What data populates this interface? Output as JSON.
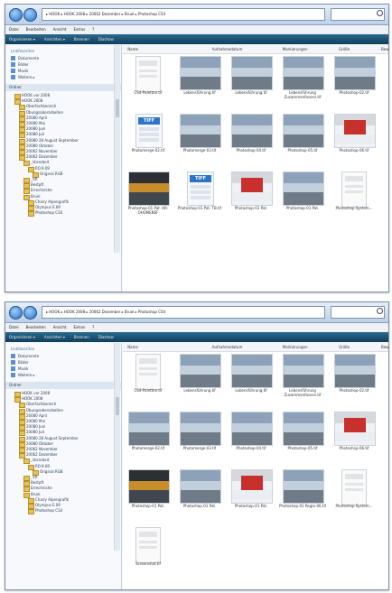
{
  "windows": [
    {
      "breadcrumb": "▸ HOOK ▸ HOOK 2008 ▸ 20062 Dezember ▸ Bruel ▸ Photoshop CS4",
      "search_placeholder": "Suchen",
      "menu": [
        "Datei",
        "Bearbeiten",
        "Ansicht",
        "Extras",
        "?"
      ],
      "toolbar": [
        "Organisieren ▾",
        "Ansichten ▾",
        "Brennen",
        "Diashow"
      ],
      "favorites_header": "Linkfavoriten",
      "favorites": [
        "Dokumente",
        "Bilder",
        "Musik",
        "Weitere ▸"
      ],
      "folders_header": "Ordner",
      "tree": [
        "HOOK vor 2008",
        "HOOK 2008",
        "Oberfachbereich",
        "Übungsaberarbeiten",
        "20080 April",
        "20080 Mai",
        "20080 Juni",
        "20080 Juli",
        "20080 28 August September",
        "20080 Oktober",
        "20062 November",
        "20062 Dezember",
        "_Vorarbeit",
        "RO.9.09",
        "Original RGB",
        "_VR",
        "Bestpft",
        "Errechnishe",
        "Bruel",
        "Chairy Alpengrafik",
        "Olympus E.09",
        "Photoshop CS4"
      ],
      "columns": [
        "Name",
        "Aufnahmedatum",
        "Markierungen",
        "Größe",
        "Bewertung"
      ],
      "files": [
        {
          "name": "CS4-Paletten.tif",
          "kind": "page"
        },
        {
          "name": "Lebensführung.tif",
          "kind": "photo"
        },
        {
          "name": "Lebensführung.tif",
          "kind": "photo"
        },
        {
          "name": "Lebensführung Zusammenfassen.tif",
          "kind": "photo"
        },
        {
          "name": "Photoshop-02.tif",
          "kind": "photo"
        },
        {
          "name": "Photomerge-02.tif",
          "kind": "tiff"
        },
        {
          "name": "Photomerge-03.tif",
          "kind": "photo"
        },
        {
          "name": "Photoshop-04.tif",
          "kind": "photo"
        },
        {
          "name": "Photoshop-05.tif",
          "kind": "photo"
        },
        {
          "name": "Photoshop-06.tif",
          "kind": "red"
        },
        {
          "name": "Photoshop-01 Pat. HR-OHUMENEF",
          "kind": "dark"
        },
        {
          "name": "Photoshop-01 Pat. TB.tif",
          "kind": "tiff"
        },
        {
          "name": "Photoshop-01 Pat.",
          "kind": "red"
        },
        {
          "name": "Photoshop-01 Pat.",
          "kind": "photo"
        },
        {
          "name": "Photoshop System...",
          "kind": "page"
        }
      ]
    },
    {
      "breadcrumb": "▸ HOOK ▸ HOOK 2008 ▸ 20062 Dezember ▸ Bruel ▸ Photoshop CS4",
      "search_placeholder": "Suchen",
      "menu": [
        "Datei",
        "Bearbeiten",
        "Ansicht",
        "Extras",
        "?"
      ],
      "toolbar": [
        "Organisieren ▾",
        "Ansichten ▾",
        "Brennen",
        "Diashow"
      ],
      "favorites_header": "Linkfavoriten",
      "favorites": [
        "Dokumente",
        "Bilder",
        "Musik",
        "Weitere ▸"
      ],
      "folders_header": "Ordner",
      "tree": [
        "HOOK vor 2008",
        "HOOK 2008",
        "Oberfachbereich",
        "Übungsaberarbeiten",
        "20080 April",
        "20080 Mai",
        "20080 Juni",
        "20080 Juli",
        "20080 28 August September",
        "20080 Oktober",
        "20062 November",
        "20062 Dezember",
        "_Vorarbeit",
        "RO.9.09",
        "Original RGB",
        "_VR",
        "Bestpft",
        "Errechnishe",
        "Bruel",
        "Chairy Alpengrafik",
        "Olympus E.09",
        "Photoshop CS4"
      ],
      "columns": [
        "Name",
        "Aufnahmedatum",
        "Markierungen",
        "Größe",
        "Bewertung"
      ],
      "files": [
        {
          "name": "CS4-Paletten.tif",
          "kind": "page"
        },
        {
          "name": "Lebensführung.tif",
          "kind": "photo"
        },
        {
          "name": "Lebensführung.tif",
          "kind": "photo"
        },
        {
          "name": "Lebensführung Zusammenfassen.tif",
          "kind": "photo"
        },
        {
          "name": "Photoshop-02.tif",
          "kind": "photo"
        },
        {
          "name": "Photomerge-02.tif",
          "kind": "photo"
        },
        {
          "name": "Photomerge-03.tif",
          "kind": "photo"
        },
        {
          "name": "Photoshop-04.tif",
          "kind": "photo"
        },
        {
          "name": "Photoshop-05.tif",
          "kind": "photo"
        },
        {
          "name": "Photoshop-06.tif",
          "kind": "red"
        },
        {
          "name": "Photoshop-01 Pat.",
          "kind": "dark"
        },
        {
          "name": "Photoshop-01 Pat.",
          "kind": "photo"
        },
        {
          "name": "Photoshop-01 Pat.",
          "kind": "red"
        },
        {
          "name": "Photoshop-01 Regio-06.tif",
          "kind": "photo"
        },
        {
          "name": "Photoshop System...",
          "kind": "page"
        },
        {
          "name": "Screenshot.tif",
          "kind": "page"
        }
      ]
    }
  ]
}
